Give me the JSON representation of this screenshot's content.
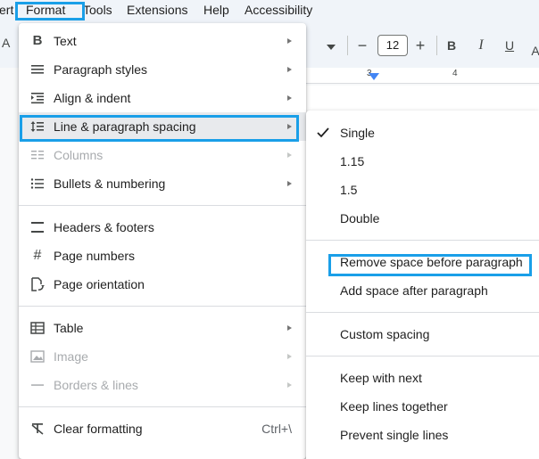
{
  "menubar": {
    "items": [
      "ert",
      "Format",
      "Tools",
      "Extensions",
      "Help",
      "Accessibility"
    ]
  },
  "toolbar": {
    "font_size": "12",
    "minus": "−",
    "plus": "+",
    "bold": "B",
    "italic": "I",
    "underline": "U",
    "partial_left": "A"
  },
  "ruler": {
    "ticks": [
      "3",
      "4"
    ]
  },
  "format_menu": {
    "items": [
      {
        "label": "Text",
        "icon": "bold-icon"
      },
      {
        "label": "Paragraph styles",
        "icon": "paragraph-styles-icon"
      },
      {
        "label": "Align & indent",
        "icon": "align-indent-icon"
      },
      {
        "label": "Line & paragraph spacing",
        "icon": "line-spacing-icon"
      },
      {
        "label": "Columns",
        "icon": "columns-icon"
      },
      {
        "label": "Bullets & numbering",
        "icon": "bullets-icon"
      },
      {
        "label": "Headers & footers",
        "icon": "headers-footers-icon"
      },
      {
        "label": "Page numbers",
        "icon": "hash-icon"
      },
      {
        "label": "Page orientation",
        "icon": "page-orientation-icon"
      },
      {
        "label": "Table",
        "icon": "table-icon"
      },
      {
        "label": "Image",
        "icon": "image-icon"
      },
      {
        "label": "Borders & lines",
        "icon": "borders-lines-icon"
      },
      {
        "label": "Clear formatting",
        "icon": "clear-formatting-icon",
        "shortcut": "Ctrl+\\"
      }
    ]
  },
  "spacing_submenu": {
    "items": [
      {
        "label": "Single",
        "checked": true
      },
      {
        "label": "1.15"
      },
      {
        "label": "1.5"
      },
      {
        "label": "Double"
      },
      {
        "label": "Remove space before paragraph"
      },
      {
        "label": "Add space after paragraph"
      },
      {
        "label": "Custom spacing"
      },
      {
        "label": "Keep with next"
      },
      {
        "label": "Keep lines together"
      },
      {
        "label": "Prevent single lines"
      }
    ]
  },
  "colors": {
    "highlight": "#1a9fe8",
    "menu_bg": "#ffffff",
    "active_bg": "#e8eaed",
    "ruler_marker": "#4285f4"
  }
}
